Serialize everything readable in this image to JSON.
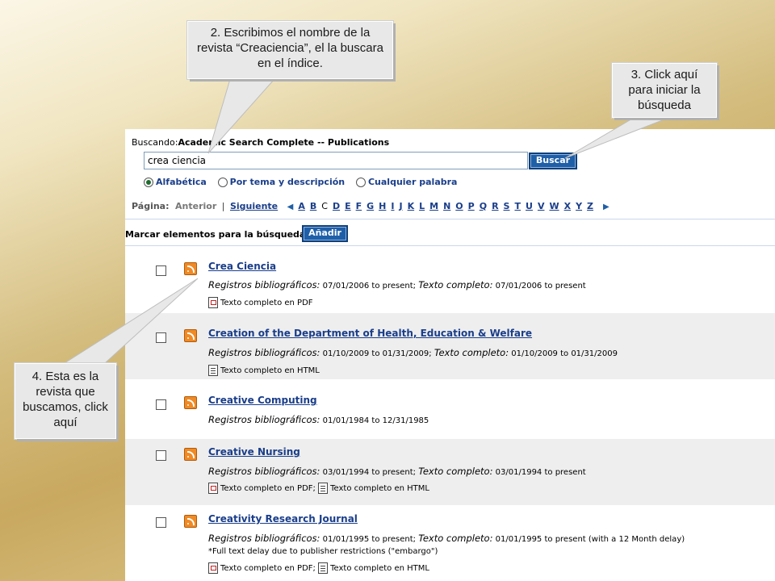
{
  "search": {
    "label": "Buscando:",
    "database": "Academic Search Complete -- Publications",
    "value": "crea ciencia",
    "button": "Buscar"
  },
  "radios": [
    {
      "label": "Alfabética",
      "checked": true
    },
    {
      "label": "Por tema y descripción",
      "checked": false
    },
    {
      "label": "Cualquier palabra",
      "checked": false
    }
  ],
  "paging": {
    "label": "Página:",
    "prev": "Anterior",
    "separator": "|",
    "next": "Siguiente",
    "letters": [
      "A",
      "B",
      "C",
      "D",
      "E",
      "F",
      "G",
      "H",
      "I",
      "J",
      "K",
      "L",
      "M",
      "N",
      "O",
      "P",
      "Q",
      "R",
      "S",
      "T",
      "U",
      "V",
      "W",
      "X",
      "Y",
      "Z"
    ],
    "current": "C"
  },
  "mark": {
    "label": "Marcar elementos para la búsqueda",
    "button": "Añadir"
  },
  "results": [
    {
      "title": "Crea Ciencia",
      "bib_label": "Registros bibliográficos:",
      "bib_range": "07/01/2006 to present",
      "sep": ";",
      "full_label": "Texto completo:",
      "full_range": "07/01/2006 to present",
      "formats": [
        "Texto completo en PDF"
      ]
    },
    {
      "title": "Creation of the Department of Health, Education & Welfare",
      "bib_label": "Registros bibliográficos:",
      "bib_range": "01/10/2009 to 01/31/2009",
      "sep": ";",
      "full_label": "Texto completo:",
      "full_range": "01/10/2009 to 01/31/2009",
      "formats": [
        "Texto completo en HTML"
      ]
    },
    {
      "title": "Creative Computing",
      "bib_label": "Registros bibliográficos:",
      "bib_range": "01/01/1984 to 12/31/1985"
    },
    {
      "title": "Creative Nursing",
      "bib_label": "Registros bibliográficos:",
      "bib_range": "03/01/1994 to present",
      "sep": ";",
      "full_label": "Texto completo:",
      "full_range": "03/01/1994 to present",
      "formats": [
        "Texto completo en PDF;",
        "Texto completo en HTML"
      ]
    },
    {
      "title": "Creativity Research Journal",
      "bib_label": "Registros bibliográficos:",
      "bib_range": "01/01/1995 to present",
      "sep": ";",
      "full_label": "Texto completo:",
      "full_range": "01/01/1995 to present (with a 12 Month delay)",
      "note": "*Full text delay due to publisher restrictions (\"embargo\")",
      "formats": [
        "Texto completo en PDF;",
        "Texto completo en HTML"
      ]
    }
  ],
  "callouts": {
    "step2": "2. Escribimos el nombre de la revista “Creaciencia”, el la buscara en el índice.",
    "step3": "3. Click aquí para iniciar la búsqueda",
    "step4": "4. Esta es la revista que buscamos, click aquí"
  },
  "colors": {
    "link": "#1a3e8a",
    "button": "#1f5fa8",
    "rss": "#f08a24",
    "row_alt": "#eeeeee"
  }
}
